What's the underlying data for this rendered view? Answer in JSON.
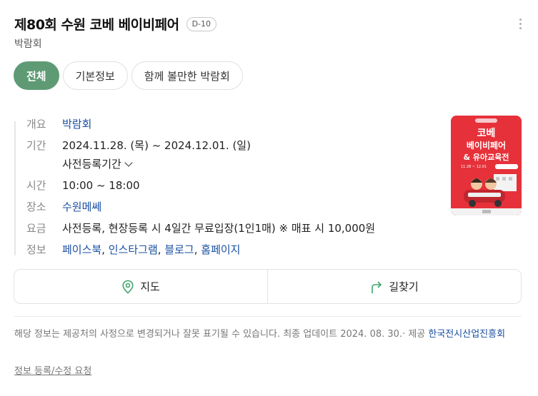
{
  "header": {
    "title": "제80회 수원 코베 베이비페어",
    "dday": "D-10",
    "subtitle": "박람회"
  },
  "tabs": [
    {
      "label": "전체",
      "active": true
    },
    {
      "label": "기본정보",
      "active": false
    },
    {
      "label": "함께 볼만한 박람회",
      "active": false
    }
  ],
  "info": {
    "overview": {
      "label": "개요",
      "value": "박람회"
    },
    "period": {
      "label": "기간",
      "value": "2024.11.28. (목) ~  2024.12.01. (일)",
      "sub": "사전등록기간"
    },
    "time": {
      "label": "시간",
      "value": "10:00 ~ 18:00"
    },
    "place": {
      "label": "장소",
      "value": "수원메쎄"
    },
    "fee": {
      "label": "요금",
      "value": "사전등록, 현장등록 시 4일간 무료입장(1인1매) ※ 매표 시 10,000원"
    },
    "links": {
      "label": "정보",
      "items": [
        "페이스북",
        "인스타그램",
        "블로그",
        "홈페이지"
      ]
    }
  },
  "poster": {
    "line1": "코베",
    "line2": "베이비페어",
    "line3": "& 유아교육전",
    "dates": "11.28 ~ 12.01",
    "colors": {
      "bg": "#e6313a",
      "text": "#ffffff"
    }
  },
  "actions": {
    "map_label": "지도",
    "route_label": "길찾기",
    "icon_color": "#3fa56a"
  },
  "notice": {
    "text": "해당 정보는 제공처의 사정으로 변경되거나 잘못 표기될 수 있습니다. 최종 업데이트 2024. 08. 30.· 제공",
    "provider": "한국전시산업진흥회"
  },
  "report_label": "정보 등록/수정 요청"
}
